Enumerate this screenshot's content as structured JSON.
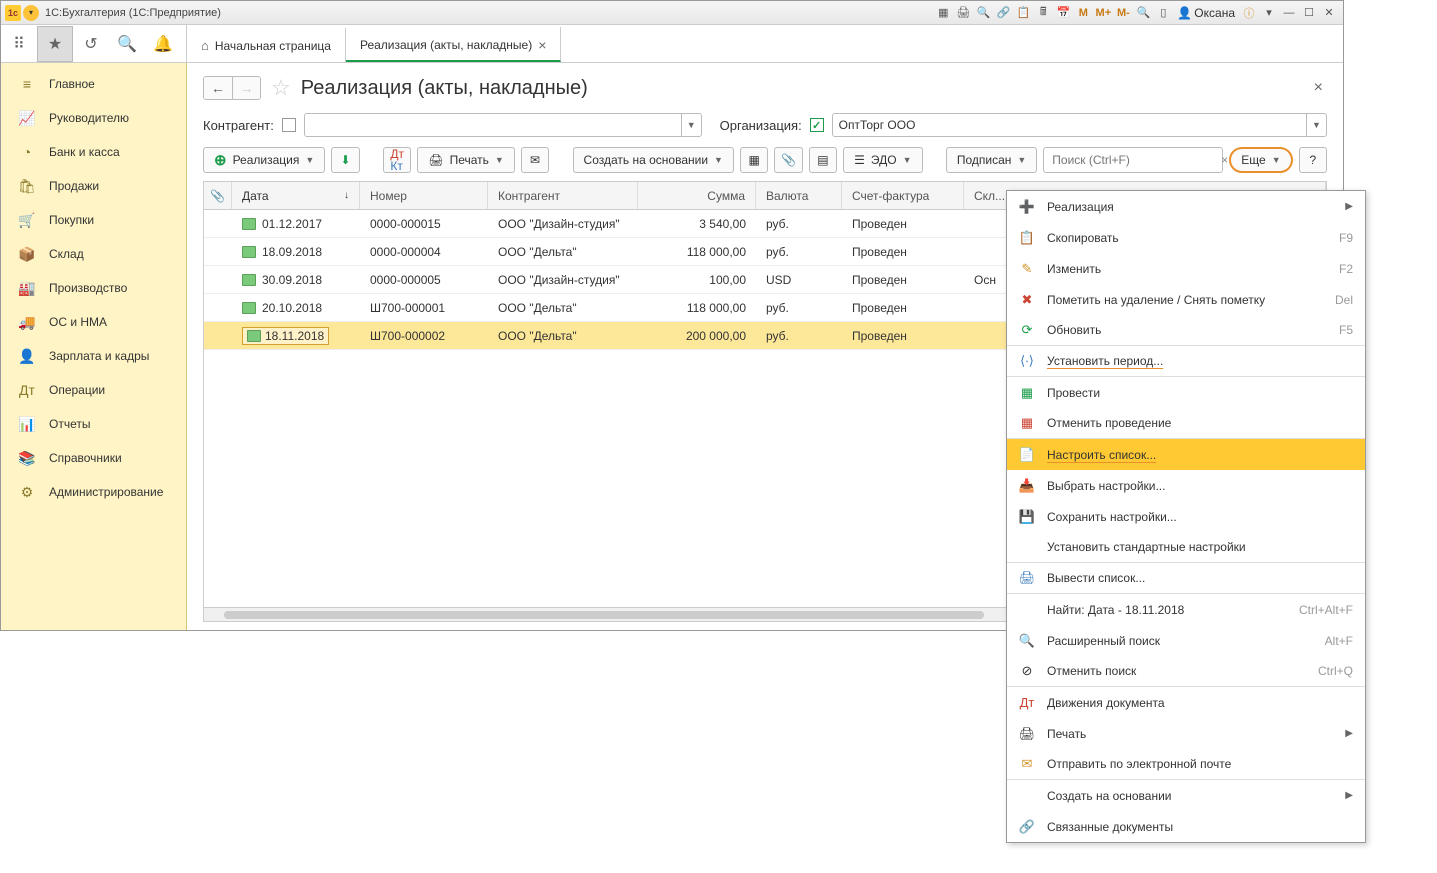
{
  "titlebar": {
    "app_title": "1С:Бухгалтерия  (1С:Предприятие)",
    "user": "Оксана",
    "m": "M",
    "mplus": "M+",
    "mminus": "M-"
  },
  "tabs": {
    "home": "Начальная страница",
    "active": "Реализация (акты, накладные)"
  },
  "sidebar": [
    {
      "icon": "≡",
      "label": "Главное"
    },
    {
      "icon": "📈",
      "label": "Руководителю"
    },
    {
      "icon": "◔",
      "label": "Банк и касса"
    },
    {
      "icon": "🛍",
      "label": "Продажи"
    },
    {
      "icon": "🛒",
      "label": "Покупки"
    },
    {
      "icon": "📦",
      "label": "Склад"
    },
    {
      "icon": "🏭",
      "label": "Производство"
    },
    {
      "icon": "🚚",
      "label": "ОС и НМА"
    },
    {
      "icon": "👤",
      "label": "Зарплата и кадры"
    },
    {
      "icon": "Дт",
      "label": "Операции"
    },
    {
      "icon": "📊",
      "label": "Отчеты"
    },
    {
      "icon": "📚",
      "label": "Справочники"
    },
    {
      "icon": "⚙",
      "label": "Администрирование"
    }
  ],
  "page": {
    "title": "Реализация (акты, накладные)",
    "contr_label": "Контрагент:",
    "org_label": "Организация:",
    "org_value": "ОптТорг ООО"
  },
  "actions": {
    "realize": "Реализация",
    "print": "Печать",
    "create_based": "Создать на основании",
    "edo": "ЭДО",
    "signed": "Подписан",
    "search_ph": "Поиск (Ctrl+F)",
    "more": "Еще",
    "help": "?",
    "dtkt": "Дт Кт"
  },
  "columns": {
    "date": "Дата",
    "num": "Номер",
    "contr": "Контрагент",
    "sum": "Сумма",
    "cur": "Валюта",
    "inv": "Счет-фактура",
    "wh": "Скл..."
  },
  "rows": [
    {
      "date": "01.12.2017",
      "num": "0000-000015",
      "contr": "ООО \"Дизайн-студия\"",
      "sum": "3 540,00",
      "cur": "руб.",
      "inv": "Проведен",
      "wh": ""
    },
    {
      "date": "18.09.2018",
      "num": "0000-000004",
      "contr": "ООО \"Дельта\"",
      "sum": "118 000,00",
      "cur": "руб.",
      "inv": "Проведен",
      "wh": ""
    },
    {
      "date": "30.09.2018",
      "num": "0000-000005",
      "contr": "ООО \"Дизайн-студия\"",
      "sum": "100,00",
      "cur": "USD",
      "inv": "Проведен",
      "wh": "Осн"
    },
    {
      "date": "20.10.2018",
      "num": "Ш700-000001",
      "contr": "ООО \"Дельта\"",
      "sum": "118 000,00",
      "cur": "руб.",
      "inv": "Проведен",
      "wh": ""
    },
    {
      "date": "18.11.2018",
      "num": "Ш700-000002",
      "contr": "ООО \"Дельта\"",
      "sum": "200 000,00",
      "cur": "руб.",
      "inv": "Проведен",
      "wh": ""
    }
  ],
  "menu": [
    {
      "icon": "➕",
      "cls": "green",
      "label": "Реализация",
      "arrow": true,
      "sep": false
    },
    {
      "icon": "📋",
      "label": "Скопировать",
      "shortcut": "F9"
    },
    {
      "icon": "✎",
      "cls": "orange-i",
      "label": "Изменить",
      "shortcut": "F2"
    },
    {
      "icon": "✖",
      "cls": "red-i",
      "label": "Пометить на удаление / Снять пометку",
      "shortcut": "Del"
    },
    {
      "icon": "⟳",
      "cls": "green",
      "label": "Обновить",
      "shortcut": "F5",
      "sep": true
    },
    {
      "icon": "⟨∙⟩",
      "cls": "blue",
      "label": "Установить период...",
      "underlined": true,
      "sep": true
    },
    {
      "icon": "▦",
      "cls": "green",
      "label": "Провести"
    },
    {
      "icon": "▦",
      "cls": "red-i",
      "label": "Отменить проведение",
      "sep": true
    },
    {
      "icon": "📄",
      "cls": "blue",
      "label": "Настроить список...",
      "highlight": true,
      "underlined": true
    },
    {
      "icon": "📥",
      "label": "Выбрать настройки..."
    },
    {
      "icon": "💾",
      "label": "Сохранить настройки..."
    },
    {
      "icon": "",
      "label": "Установить стандартные настройки",
      "sep": true
    },
    {
      "icon": "🖨",
      "cls": "blue",
      "label": "Вывести список...",
      "sep": true
    },
    {
      "icon": "",
      "label": "Найти: Дата - 18.11.2018",
      "shortcut": "Ctrl+Alt+F"
    },
    {
      "icon": "🔍",
      "label": "Расширенный поиск",
      "shortcut": "Alt+F"
    },
    {
      "icon": "⊘",
      "label": "Отменить поиск",
      "shortcut": "Ctrl+Q",
      "disabled": true,
      "sep": true
    },
    {
      "icon": "Дт",
      "cls": "red-i",
      "label": "Движения документа"
    },
    {
      "icon": "🖨",
      "label": "Печать",
      "arrow": true
    },
    {
      "icon": "✉",
      "cls": "orange-i",
      "label": "Отправить по электронной почте",
      "sep": true
    },
    {
      "icon": "",
      "label": "Создать на основании",
      "arrow": true
    },
    {
      "icon": "🔗",
      "label": "Связанные документы"
    }
  ]
}
